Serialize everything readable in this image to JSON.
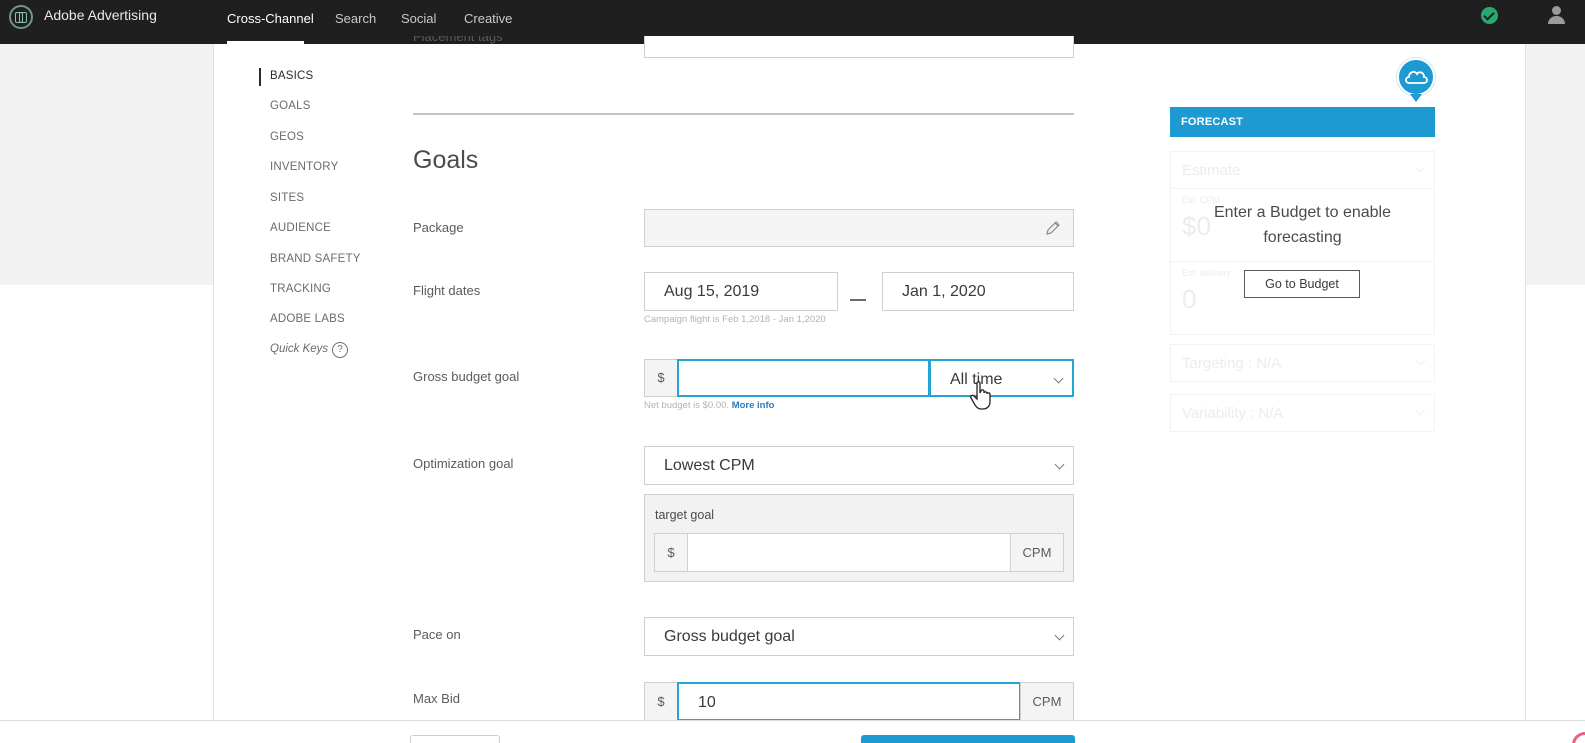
{
  "topbar": {
    "brand": "Adobe Advertising",
    "tabs": [
      {
        "label": "Cross-Channel",
        "active": true
      },
      {
        "label": "Search",
        "active": false
      },
      {
        "label": "Social",
        "active": false
      },
      {
        "label": "Creative",
        "active": false
      }
    ]
  },
  "sidenav": {
    "items": [
      "BASICS",
      "GOALS",
      "GEOS",
      "INVENTORY",
      "SITES",
      "AUDIENCE",
      "BRAND SAFETY",
      "TRACKING",
      "ADOBE LABS"
    ],
    "active": "BASICS",
    "quick_keys": "Quick Keys",
    "help_glyph": "?"
  },
  "form": {
    "placement_tags_label": "Placement tags",
    "section_title": "Goals",
    "package": {
      "label": "Package",
      "value": ""
    },
    "flight_dates": {
      "label": "Flight dates",
      "start": "Aug 15, 2019",
      "end": "Jan 1, 2020",
      "hint": "Campaign flight is Feb 1,2018 - Jan 1,2020"
    },
    "gross_budget": {
      "label": "Gross budget goal",
      "currency": "$",
      "value": "",
      "period": "All time",
      "hint": "Net budget is $0.00.",
      "hint_link": "More info"
    },
    "optimization_goal": {
      "label": "Optimization goal",
      "value": "Lowest CPM",
      "target_goal_label": "target goal",
      "currency": "$",
      "target_value": "",
      "unit": "CPM"
    },
    "pace_on": {
      "label": "Pace on",
      "value": "Gross budget goal"
    },
    "max_bid": {
      "label": "Max Bid",
      "currency": "$",
      "value": "10",
      "unit": "CPM"
    }
  },
  "forecast": {
    "header": "FORECAST",
    "message_line1": "Enter a Budget to enable",
    "message_line2": "forecasting",
    "button": "Go to Budget",
    "faded": {
      "estimate": "Estimate",
      "est_cpm_label": "Est. CPM",
      "est_cpm_value": "$0",
      "est_delivery_label": "Est. delivery",
      "est_delivery_value": "0",
      "targeting": "Targeting : N/A",
      "variability": "Variability : N/A"
    }
  },
  "colors": {
    "accent": "#1e9ad3",
    "focus": "#24a3d6",
    "topbar": "#1f1f1f",
    "status_ok": "#2aa872"
  },
  "icons": [
    "adobe-advertising-logo-icon",
    "status-check-icon",
    "user-icon",
    "pencil-icon",
    "chevron-down-icon",
    "cloud-icon",
    "help-icon",
    "hand-cursor-icon"
  ]
}
